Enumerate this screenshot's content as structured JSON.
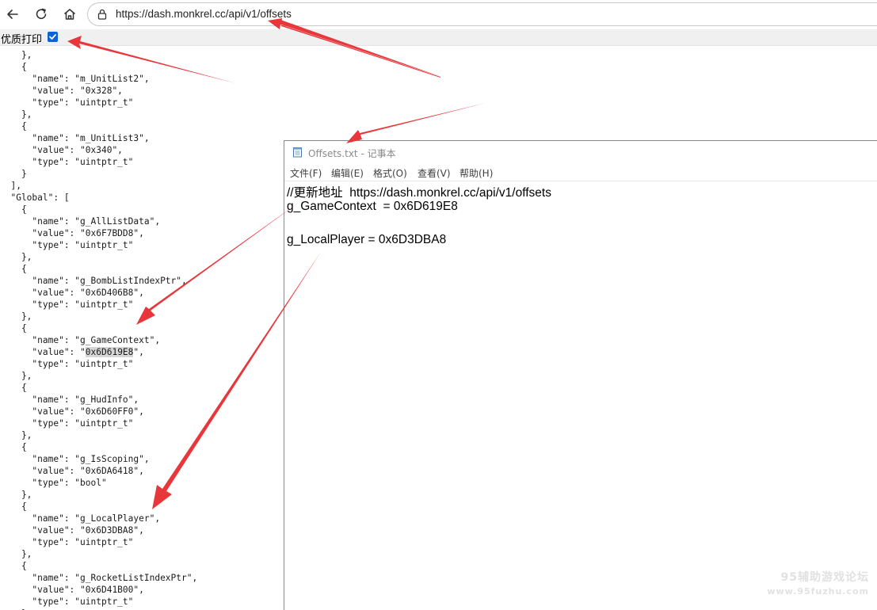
{
  "browser": {
    "url": "https://dash.monkrel.cc/api/v1/offsets",
    "print_label": "优质打印"
  },
  "json_lines": [
    "    },",
    "    {",
    "      \"name\": \"m_UnitList2\",",
    "      \"value\": \"0x328\",",
    "      \"type\": \"uintptr_t\"",
    "    },",
    "    {",
    "      \"name\": \"m_UnitList3\",",
    "      \"value\": \"0x340\",",
    "      \"type\": \"uintptr_t\"",
    "    }",
    "  ],",
    "  \"Global\": [",
    "    {",
    "      \"name\": \"g_AllListData\",",
    "      \"value\": \"0x6F7BDD8\",",
    "      \"type\": \"uintptr_t\"",
    "    },",
    "    {",
    "      \"name\": \"g_BombListIndexPtr\",",
    "      \"value\": \"0x6D406B8\",",
    "      \"type\": \"uintptr_t\"",
    "    },",
    "    {",
    "      \"name\": \"g_GameContext\",",
    "      \"value\": \"0x6D619E8\",",
    "      \"type\": \"uintptr_t\"",
    "    },",
    "    {",
    "      \"name\": \"g_HudInfo\",",
    "      \"value\": \"0x6D60FF0\",",
    "      \"type\": \"uintptr_t\"",
    "    },",
    "    {",
    "      \"name\": \"g_IsScoping\",",
    "      \"value\": \"0x6DA6418\",",
    "      \"type\": \"bool\"",
    "    },",
    "    {",
    "      \"name\": \"g_LocalPlayer\",",
    "      \"value\": \"0x6D3DBA8\",",
    "      \"type\": \"uintptr_t\"",
    "    },",
    "    {",
    "      \"name\": \"g_RocketListIndexPtr\",",
    "      \"value\": \"0x6D41B00\",",
    "      \"type\": \"uintptr_t\"",
    "    }"
  ],
  "json_highlight": {
    "line_index": 25,
    "prefix": "      \"value\": \"",
    "value": "0x6D619E8",
    "suffix": "\","
  },
  "notepad": {
    "title": "Offsets.txt - 记事本",
    "menu": [
      "文件(F)",
      "编辑(E)",
      "格式(O)",
      "查看(V)",
      "帮助(H)"
    ],
    "lines": [
      "//更新地址  https://dash.monkrel.cc/api/v1/offsets",
      "g_GameContext  = 0x6D619E8",
      "",
      "g_LocalPlayer = 0x6D3DBA8"
    ]
  },
  "watermark": {
    "line1": "95辅助游戏论坛",
    "line2": "www.95fuzhu.com"
  },
  "colors": {
    "arrow": "#e8363a",
    "checkbox": "#0b63d6",
    "highlight": "#d6d6d6"
  }
}
